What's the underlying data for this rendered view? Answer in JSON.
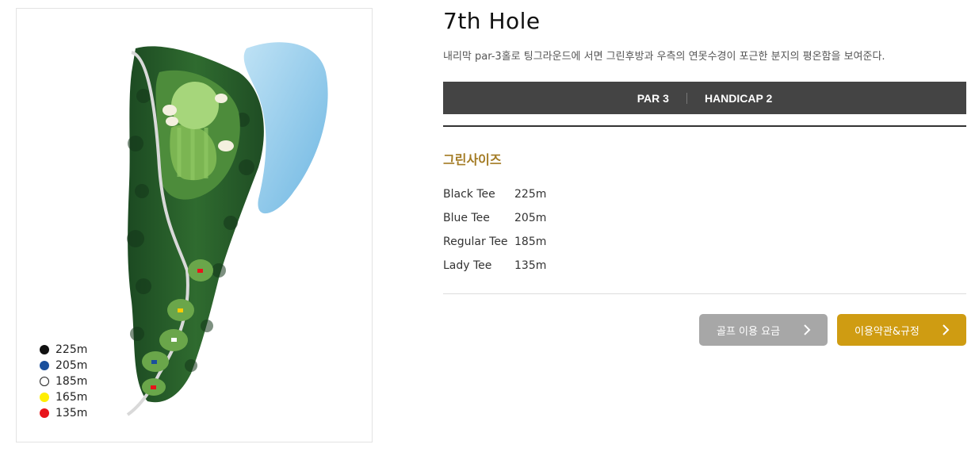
{
  "hole": {
    "title": "7th Hole",
    "description": "내리막 par-3홀로 팅그라운드에 서면 그린후방과 우측의 연못수경이 포근한 분지의 평온함을 보여준다."
  },
  "info_bar": {
    "par": "PAR 3",
    "handicap": "HANDICAP 2"
  },
  "green_size": {
    "heading": "그린사이즈",
    "tees": [
      {
        "name": "Black Tee",
        "distance": "225m"
      },
      {
        "name": "Blue Tee",
        "distance": "205m"
      },
      {
        "name": "Regular Tee",
        "distance": "185m"
      },
      {
        "name": "Lady Tee",
        "distance": "135m"
      }
    ]
  },
  "legend": [
    {
      "color": "#111111",
      "distance": "225m"
    },
    {
      "color": "#1a4f9c",
      "distance": "205m"
    },
    {
      "color": "#ffffff",
      "distance": "185m"
    },
    {
      "color": "#ffee00",
      "distance": "165m"
    },
    {
      "color": "#e8141b",
      "distance": "135m"
    }
  ],
  "buttons": {
    "golf_fee": "골프 이용 요금",
    "terms": "이용약관&규정"
  },
  "map": {
    "icons": [
      "course-map-illustration",
      "pond",
      "green",
      "fairway",
      "tee-markers"
    ]
  }
}
